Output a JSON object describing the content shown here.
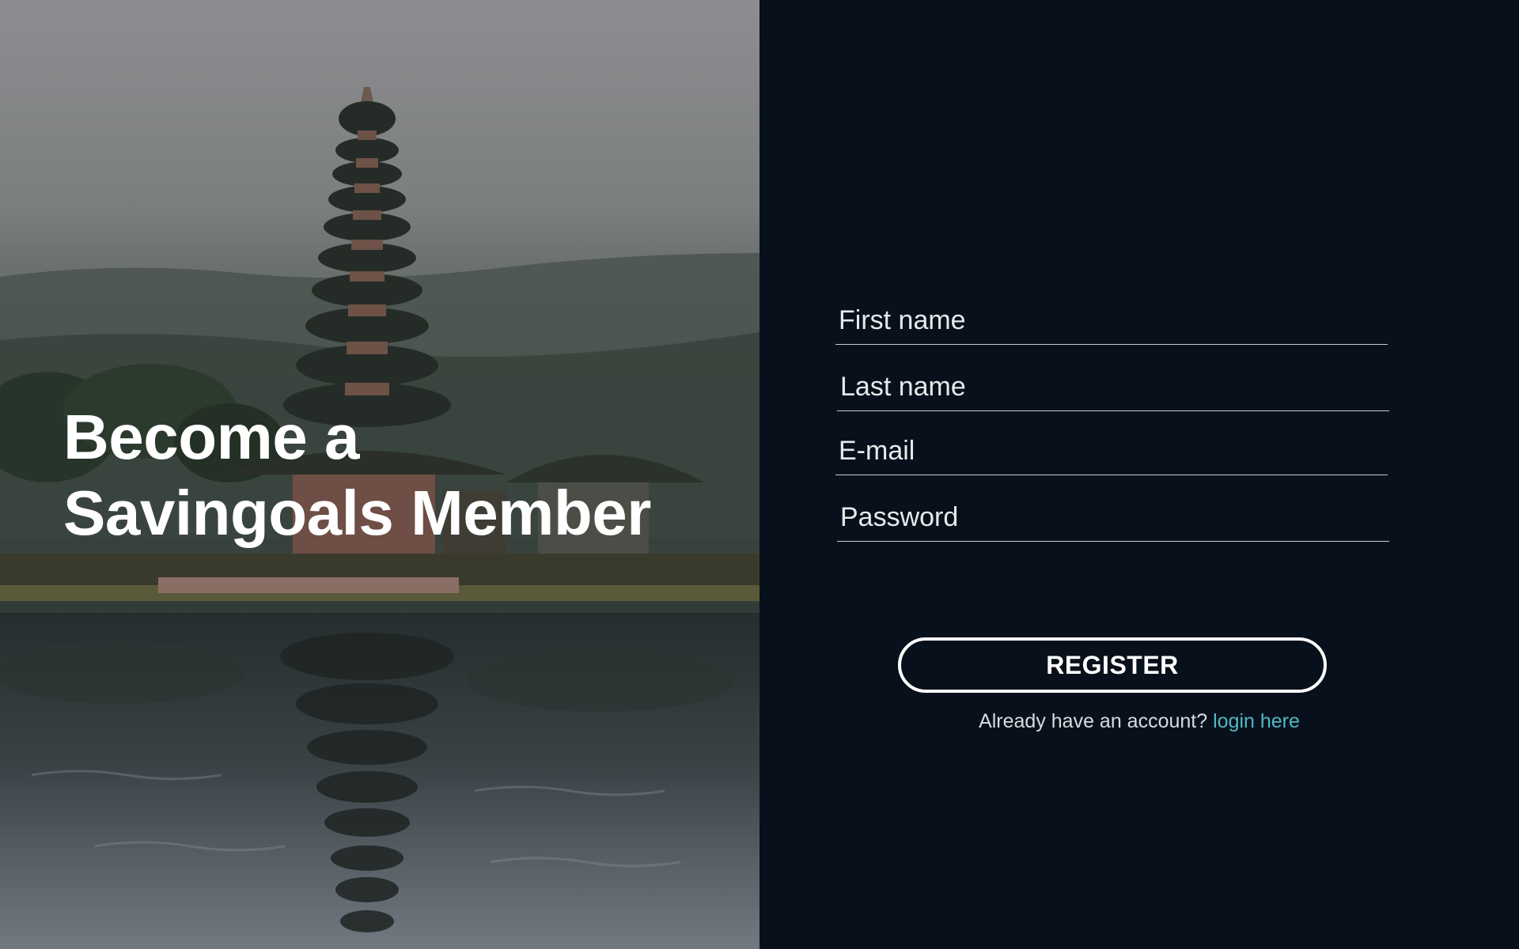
{
  "hero": {
    "title": "Become a Savingoals Member"
  },
  "form": {
    "first_name_placeholder": "First name",
    "last_name_placeholder": "Last name",
    "email_placeholder": "E-mail",
    "password_placeholder": "Password",
    "register_label": "REGISTER",
    "login_prompt": "Already have an account?",
    "login_link_label": "login here"
  },
  "colors": {
    "panel_background": "#08111b",
    "link_accent": "#4fb8c4",
    "text": "#ffffff"
  }
}
